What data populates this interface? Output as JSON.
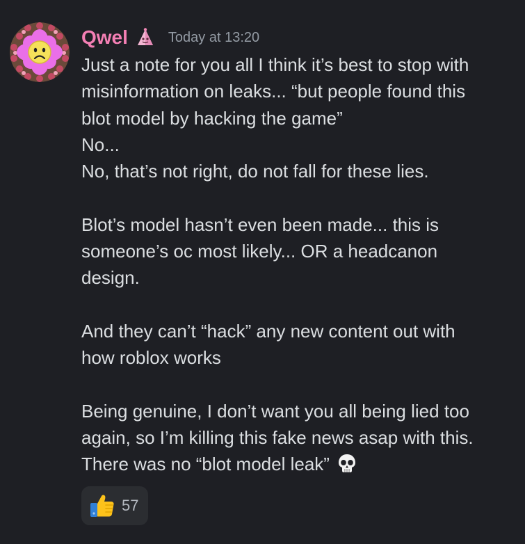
{
  "message": {
    "author": "Qwel",
    "author_color": "#f47fb4",
    "role_icon": "pink-pyramid-icon",
    "timestamp": "Today at 13:20",
    "avatar_icon": "flower-face-icon",
    "lines": [
      "Just a note for you all I think it’s best to  stop with",
      "misinformation on leaks...  “but people found this",
      "blot model by hacking the game”",
      "No...",
      "No, that’s not right, do not fall for these lies.",
      "",
      "Blot’s model hasn’t even been made... this is",
      "someone’s oc most likely... OR a headcanon",
      "design.",
      "",
      "And they can’t “hack” any new content out with",
      "how roblox works",
      "",
      "Being genuine, I don’t want you all being lied too",
      "again, so I’m killing this fake news asap with this.",
      "There was no “blot model leak”"
    ],
    "trailing_emoji": "skull-icon"
  },
  "reaction": {
    "emoji": "thumbs-up-icon",
    "count": "57"
  },
  "colors": {
    "background": "#1e1f24",
    "text": "#dbdee1",
    "muted": "#949ba4",
    "reaction_bg": "#2b2d31"
  }
}
